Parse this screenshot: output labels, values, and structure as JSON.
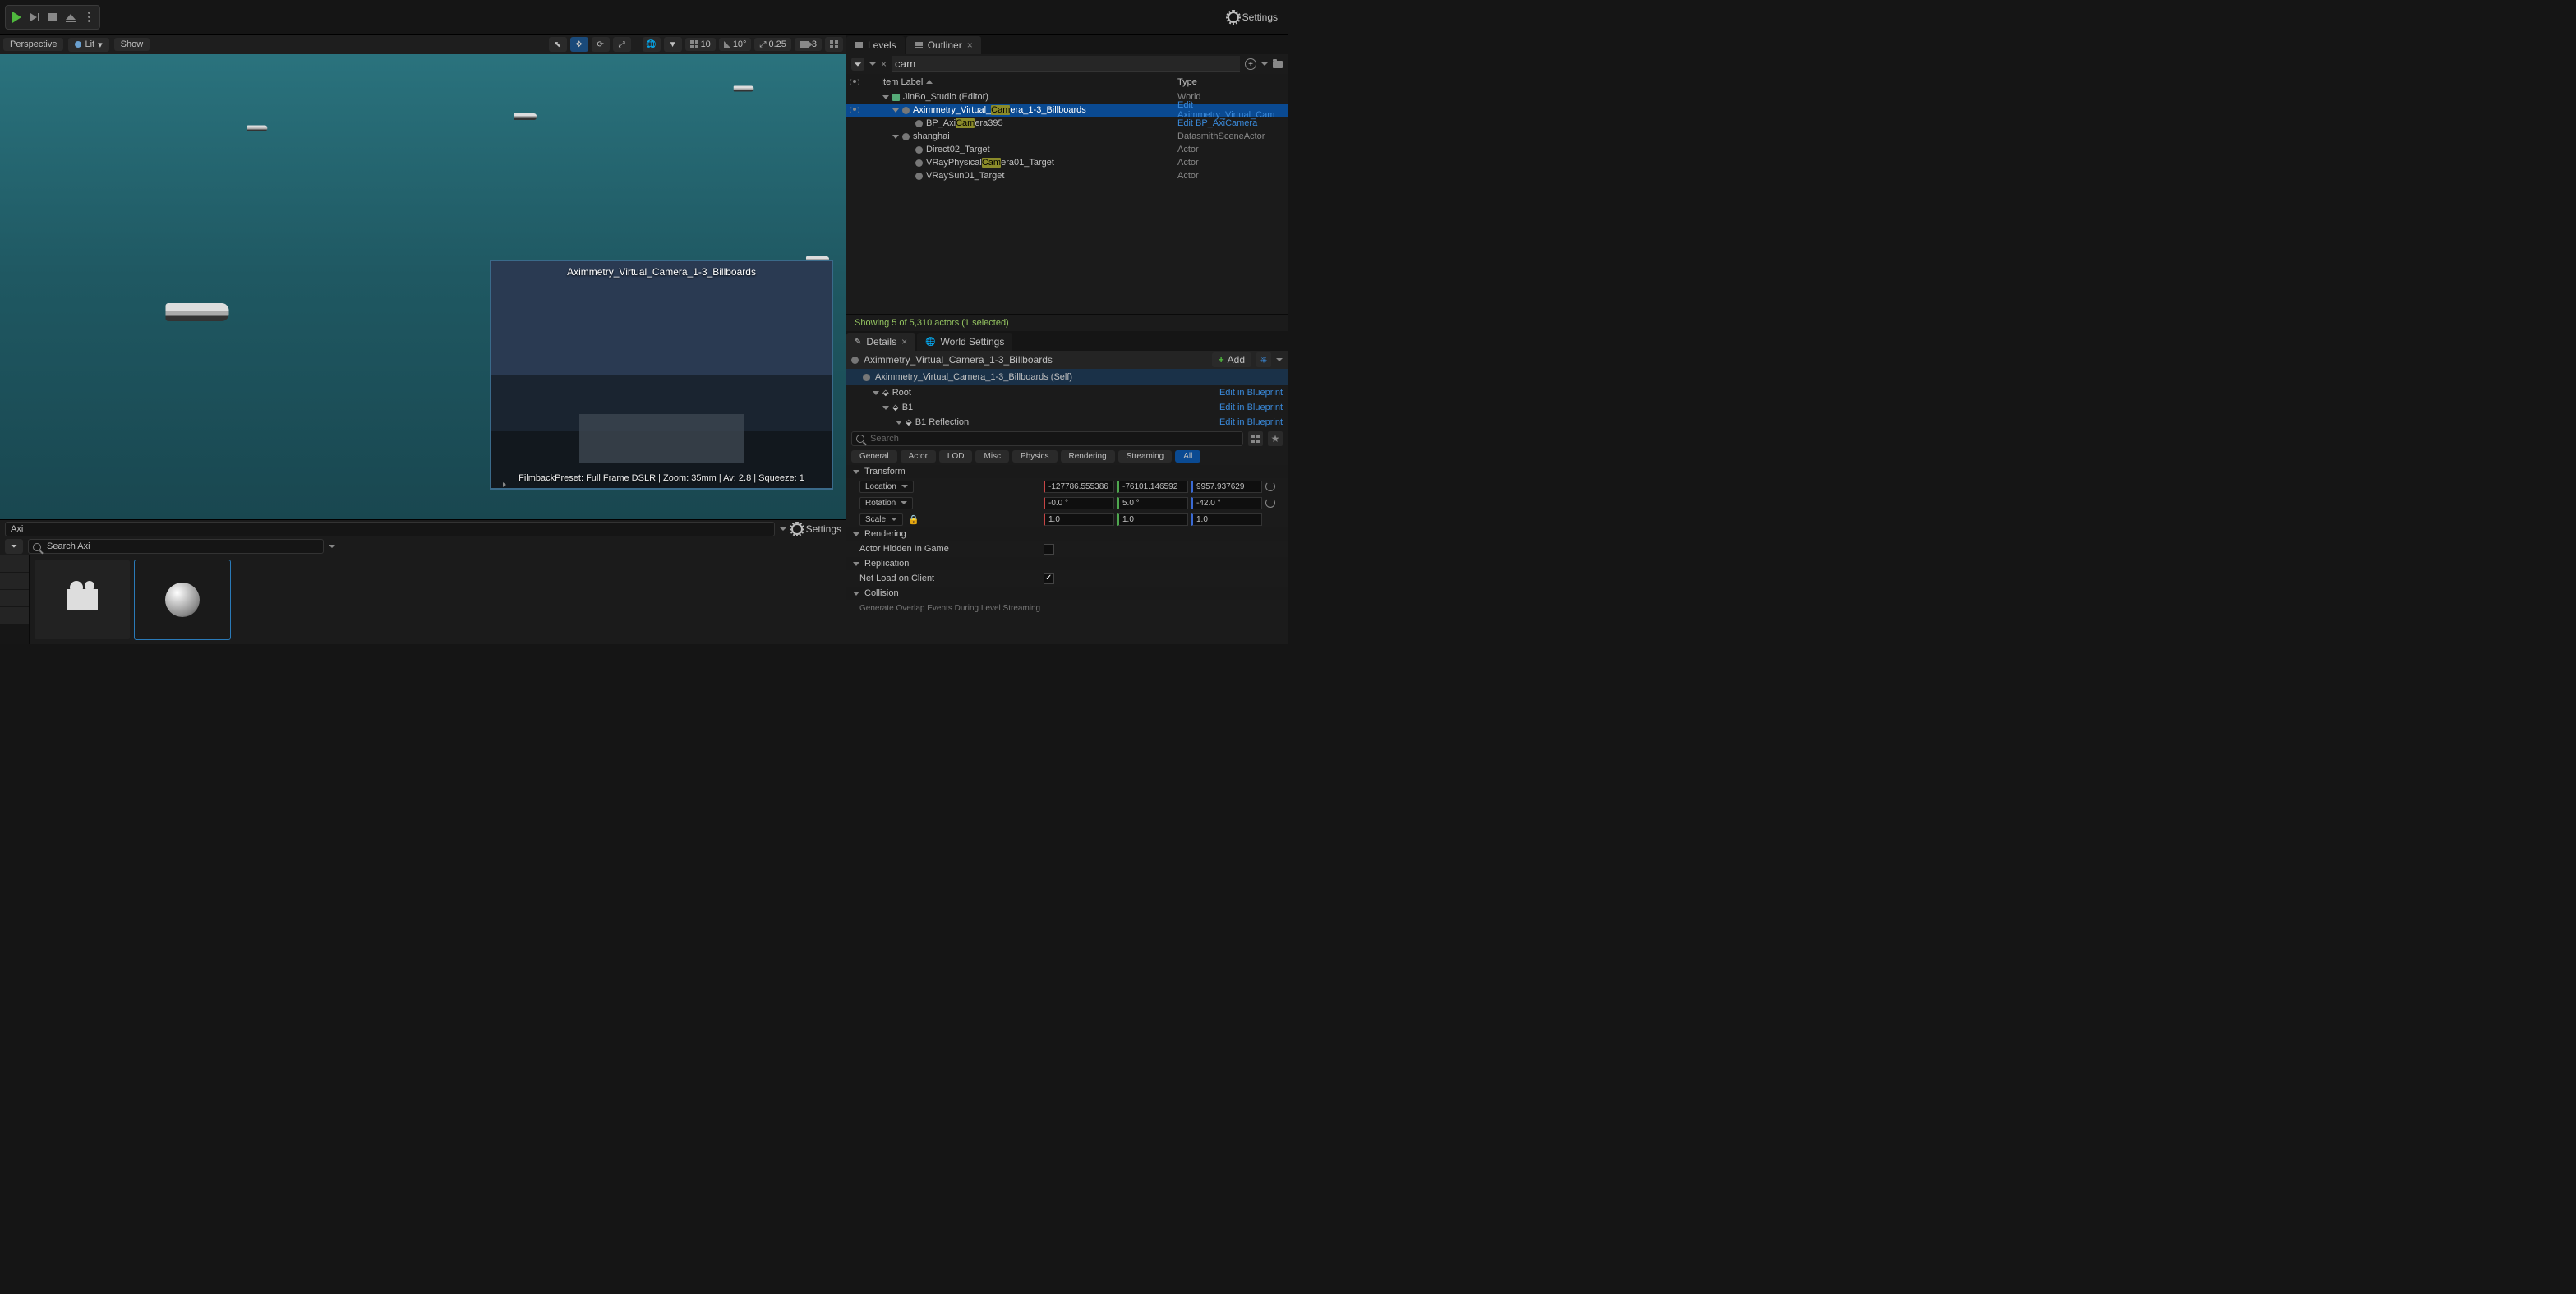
{
  "top": {
    "settings": "Settings"
  },
  "viewport": {
    "perspective": "Perspective",
    "lit": "Lit",
    "show": "Show",
    "grid_snap": "10",
    "angle_snap": "10°",
    "scale_snap": "0.25",
    "cam_speed": "3",
    "preview_title": "Aximmetry_Virtual_Camera_1-3_Billboards",
    "preview_info": "FilmbackPreset: Full Frame DSLR | Zoom: 35mm | Av: 2.8 | Squeeze: 1"
  },
  "cb": {
    "path": "Axi",
    "settings": "Settings",
    "search": "Search Axi"
  },
  "outliner": {
    "tab_levels": "Levels",
    "tab_outliner": "Outliner",
    "search": "cam",
    "header_label": "Item Label",
    "header_type": "Type",
    "rows": [
      {
        "indent": 24,
        "expand": "down",
        "icon": "world",
        "label_pre": "JinBo_Studio (Editor)",
        "hl": "",
        "label_post": "",
        "type": "World",
        "type_link": false,
        "sel": false,
        "vis": false
      },
      {
        "indent": 36,
        "expand": "down",
        "icon": "actor",
        "label_pre": "Aximmetry_Virtual_",
        "hl": "Cam",
        "label_post": "era_1-3_Billboards",
        "type": "Edit Aximmetry_Virtual_Cam",
        "type_link": true,
        "sel": true,
        "vis": true
      },
      {
        "indent": 52,
        "expand": "",
        "icon": "actor",
        "label_pre": "BP_Axi",
        "hl": "Cam",
        "label_post": "era395",
        "type": "Edit BP_AxiCamera",
        "type_link": true,
        "sel": false,
        "vis": false
      },
      {
        "indent": 36,
        "expand": "down",
        "icon": "actor",
        "label_pre": "shanghai",
        "hl": "",
        "label_post": "",
        "type": "DatasmithSceneActor",
        "type_link": false,
        "sel": false,
        "vis": false
      },
      {
        "indent": 52,
        "expand": "",
        "icon": "actor",
        "label_pre": "Direct02_Target",
        "hl": "",
        "label_post": "",
        "type": "Actor",
        "type_link": false,
        "sel": false,
        "vis": false
      },
      {
        "indent": 52,
        "expand": "",
        "icon": "actor",
        "label_pre": "VRayPhysical",
        "hl": "Cam",
        "label_post": "era01_Target",
        "type": "Actor",
        "type_link": false,
        "sel": false,
        "vis": false
      },
      {
        "indent": 52,
        "expand": "",
        "icon": "actor",
        "label_pre": "VRaySun01_Target",
        "hl": "",
        "label_post": "",
        "type": "Actor",
        "type_link": false,
        "sel": false,
        "vis": false
      }
    ],
    "footer": "Showing 5 of 5,310 actors (1 selected)"
  },
  "details": {
    "tab_details": "Details",
    "tab_world": "World Settings",
    "actor": "Aximmetry_Virtual_Camera_1-3_Billboards",
    "add": "Add",
    "self": "Aximmetry_Virtual_Camera_1-3_Billboards (Self)",
    "components": [
      {
        "indent": 16,
        "name": "Root",
        "edit": "Edit in Blueprint"
      },
      {
        "indent": 28,
        "name": "B1",
        "edit": "Edit in Blueprint"
      },
      {
        "indent": 44,
        "name": "B1 Reflection",
        "edit": "Edit in Blueprint"
      }
    ],
    "search_ph": "Search",
    "filters": [
      "General",
      "Actor",
      "LOD",
      "Misc",
      "Physics",
      "Rendering",
      "Streaming",
      "All"
    ],
    "transform": {
      "title": "Transform",
      "location_lbl": "Location",
      "location": [
        "-127786.555386",
        "-76101.146592",
        "9957.937629"
      ],
      "rotation_lbl": "Rotation",
      "rotation": [
        "-0.0 °",
        "5.0 °",
        "-42.0 °"
      ],
      "scale_lbl": "Scale",
      "scale": [
        "1.0",
        "1.0",
        "1.0"
      ]
    },
    "rendering": {
      "title": "Rendering",
      "hidden_lbl": "Actor Hidden In Game"
    },
    "replication": {
      "title": "Replication",
      "net_lbl": "Net Load on Client"
    },
    "collision": {
      "title": "Collision",
      "overlap_lbl": "Generate Overlap Events During Level Streaming"
    }
  }
}
